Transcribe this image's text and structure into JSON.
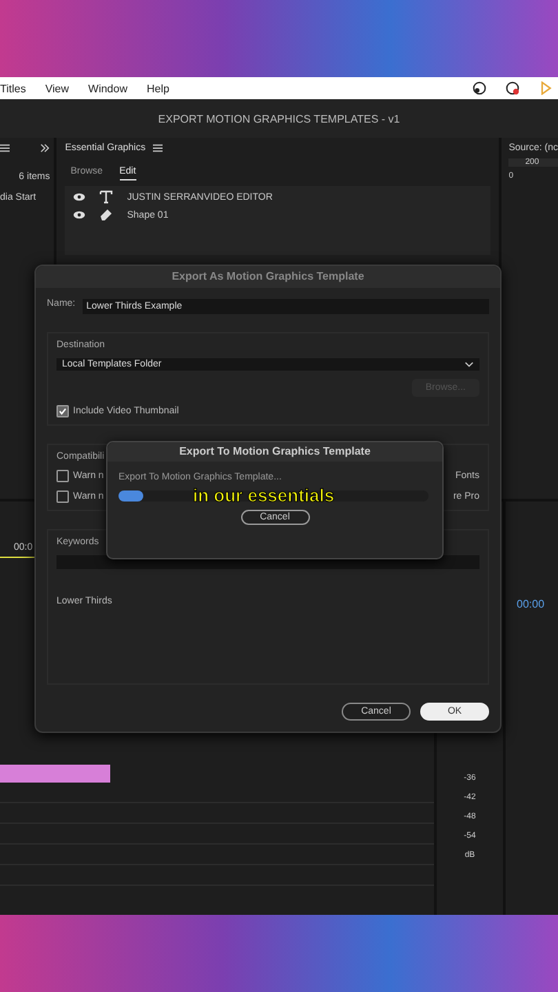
{
  "menu_bar": {
    "items": [
      "Titles",
      "View",
      "Window",
      "Help"
    ]
  },
  "window": {
    "title": "EXPORT MOTION GRAPHICS TEMPLATES - v1"
  },
  "left_panel": {
    "item_count": "6 items",
    "item": "dia Start",
    "timecode": "00:0"
  },
  "essential_graphics": {
    "title": "Essential Graphics",
    "tabs": [
      {
        "label": "Browse",
        "selected": false
      },
      {
        "label": "Edit",
        "selected": true
      }
    ],
    "layers": [
      {
        "kind": "text",
        "name": "JUSTIN SERRANVIDEO EDITOR"
      },
      {
        "kind": "shape",
        "name": "Shape 01"
      }
    ]
  },
  "meter": {
    "labels": [
      "-36",
      "-42",
      "-48",
      "-54",
      "dB"
    ]
  },
  "source_monitor": {
    "title": "Source: (nc",
    "ruler_h": "200",
    "ruler_v": "0",
    "timecode": "00:00"
  },
  "export_dialog": {
    "title": "Export As Motion Graphics Template",
    "name_label": "Name:",
    "name_value": "Lower Thirds Example",
    "destination_label": "Destination",
    "destination": "Local Templates Folder",
    "browse_button": {
      "label": "Browse...",
      "disabled": true
    },
    "include_thumbnail": {
      "label": "Include Video Thumbnail",
      "checked": true
    },
    "compatibility_label": "Compatibili",
    "warnings": [
      {
        "label": "Warn n",
        "tail": "Fonts",
        "checked": false
      },
      {
        "label": "Warn n",
        "tail": "re Pro",
        "checked": false
      }
    ],
    "keywords_label": "Keywords",
    "keyword": "Lower Thirds",
    "buttons": [
      {
        "label": "Cancel",
        "kind": "secondary"
      },
      {
        "label": "OK",
        "kind": "primary"
      }
    ]
  },
  "progress_dialog": {
    "title": "Export To Motion Graphics Template",
    "message": "Export To Motion Graphics Template...",
    "level": 0.08,
    "cancel": "Cancel"
  },
  "caption": "in our essentials"
}
